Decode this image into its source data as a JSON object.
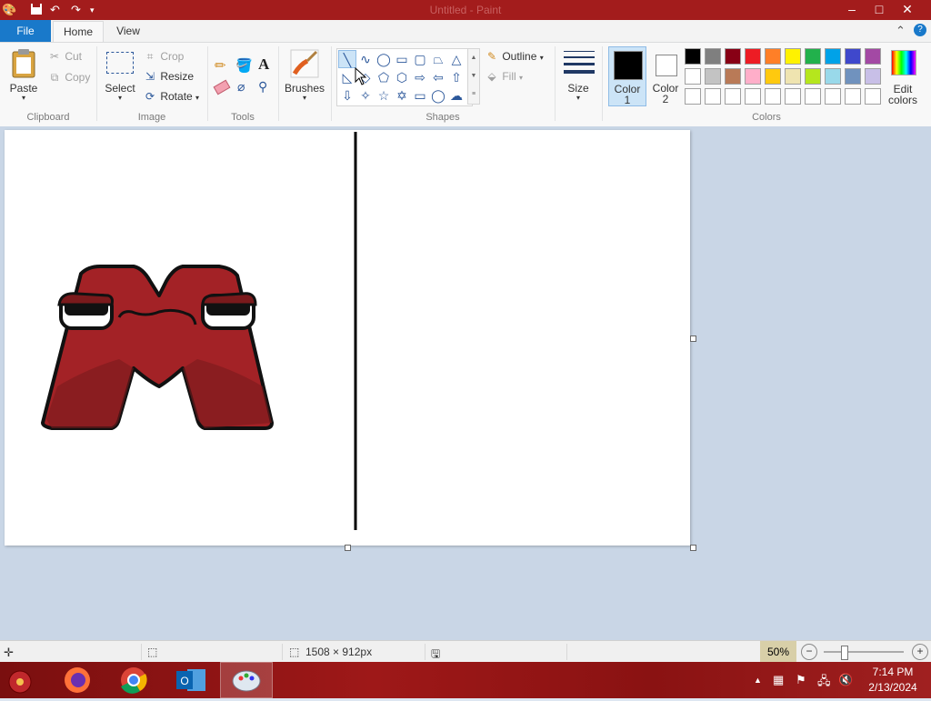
{
  "window": {
    "title": "Untitled - Paint",
    "qat_icons": [
      "paint-app-icon",
      "save-icon",
      "undo-icon",
      "redo-icon",
      "customize-qat-icon"
    ],
    "controls": [
      "minimize-icon",
      "maximize-icon",
      "close-icon"
    ],
    "title_color": "#a31c1c"
  },
  "tabs": {
    "file": "File",
    "home": "Home",
    "view": "View",
    "accent": "#1979ca"
  },
  "ribbon": {
    "clipboard": {
      "label": "Clipboard",
      "paste": "Paste",
      "cut": "Cut",
      "copy": "Copy"
    },
    "image": {
      "label": "Image",
      "select": "Select",
      "crop": "Crop",
      "resize": "Resize",
      "rotate": "Rotate"
    },
    "tools": {
      "label": "Tools"
    },
    "brushes": {
      "label": "Brushes"
    },
    "shapes": {
      "label": "Shapes",
      "outline": "Outline",
      "fill": "Fill"
    },
    "size": {
      "label": "Size"
    },
    "colors": {
      "label": "Colors",
      "color1": "Color",
      "color1_num": "1",
      "color2": "Color",
      "color2_num": "2",
      "edit": "Edit",
      "edit2": "colors",
      "color1_value": "#000000",
      "color2_value": "#ffffff",
      "palette_row1": [
        "#000000",
        "#7f7f7f",
        "#880015",
        "#ed1c24",
        "#ff7f27",
        "#fff200",
        "#22b14c",
        "#00a2e8",
        "#3f48cc",
        "#a349a4"
      ],
      "palette_row2": [
        "#ffffff",
        "#c3c3c3",
        "#b97a57",
        "#ffaec9",
        "#ffc90e",
        "#efe4b0",
        "#b5e61d",
        "#99d9ea",
        "#7092be",
        "#c8bfe7"
      ],
      "palette_row3": [
        "#ffffff",
        "#ffffff",
        "#ffffff",
        "#ffffff",
        "#ffffff",
        "#ffffff",
        "#ffffff",
        "#ffffff",
        "#ffffff",
        "#ffffff"
      ]
    }
  },
  "status": {
    "dimensions": "1508 × 912px",
    "zoom": "50%",
    "zoom_level": 0.5
  },
  "taskbar": {
    "apps": [
      "paint-start-icon",
      "firefox-icon",
      "chrome-icon",
      "outlook-icon",
      "paint-icon"
    ],
    "time": "7:14 PM",
    "date": "2/13/2024"
  }
}
